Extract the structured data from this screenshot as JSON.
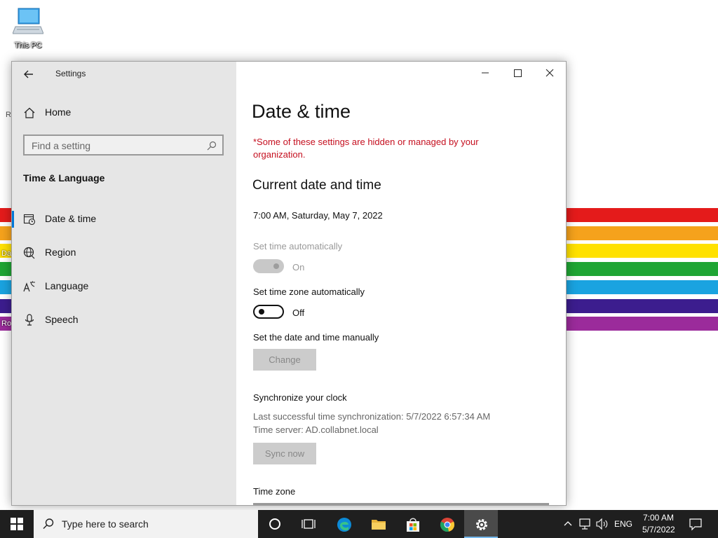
{
  "desktop": {
    "icon_label": "This PC",
    "edge_labels": [
      "R",
      "Da",
      "Ro"
    ],
    "rainbow_colors": [
      "#e41b1b",
      "#f5a21c",
      "#ffe100",
      "#1fa534",
      "#1aa3e0",
      "#3c1d8e",
      "#9b2b9b"
    ]
  },
  "window": {
    "title": "Settings",
    "controls": {
      "minimize": "minimize",
      "maximize": "maximize",
      "close": "close"
    }
  },
  "sidebar": {
    "home_label": "Home",
    "search_placeholder": "Find a setting",
    "section_title": "Time & Language",
    "items": [
      {
        "label": "Date & time",
        "icon": "date-time-icon",
        "active": true
      },
      {
        "label": "Region",
        "icon": "globe-icon",
        "active": false
      },
      {
        "label": "Language",
        "icon": "language-icon",
        "active": false
      },
      {
        "label": "Speech",
        "icon": "microphone-icon",
        "active": false
      }
    ]
  },
  "content": {
    "page_title": "Date & time",
    "warning": "*Some of these settings are hidden or managed by your organization.",
    "current_heading": "Current date and time",
    "current_datetime": "7:00 AM, Saturday, May 7, 2022",
    "set_time_auto": {
      "label": "Set time automatically",
      "state": "On",
      "disabled": true
    },
    "set_tz_auto": {
      "label": "Set time zone automatically",
      "state": "Off"
    },
    "manual": {
      "label": "Set the date and time manually",
      "button": "Change"
    },
    "sync": {
      "heading": "Synchronize your clock",
      "last_sync": "Last successful time synchronization: 5/7/2022 6:57:34 AM",
      "server": "Time server: AD.collabnet.local",
      "button": "Sync now"
    },
    "time_zone_label": "Time zone"
  },
  "taskbar": {
    "search_placeholder": "Type here to search",
    "language": "ENG",
    "time": "7:00 AM",
    "date": "5/7/2022",
    "accent": "#76b9ed"
  }
}
